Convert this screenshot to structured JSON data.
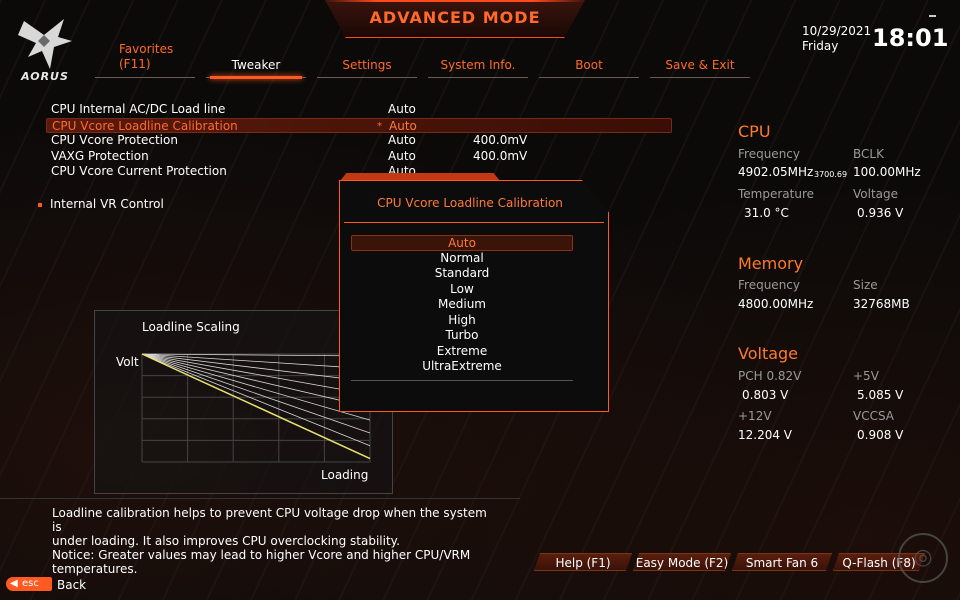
{
  "header": {
    "mode_title": "ADVANCED MODE",
    "logo_text": "AORUS",
    "date": "10/29/2021",
    "day": "Friday",
    "time": "18:01"
  },
  "tabs": [
    {
      "label": "Favorites",
      "sublabel": "(F11)"
    },
    {
      "label": "Tweaker",
      "active": true
    },
    {
      "label": "Settings"
    },
    {
      "label": "System Info."
    },
    {
      "label": "Boot"
    },
    {
      "label": "Save & Exit"
    }
  ],
  "settings": [
    {
      "label": "CPU Internal AC/DC Load line",
      "value": "Auto",
      "value2": ""
    },
    {
      "label": "CPU Vcore Loadline Calibration",
      "value": "Auto",
      "value2": "",
      "selected": true,
      "modified_mark": "*"
    },
    {
      "label": "CPU Vcore Protection",
      "value": "Auto",
      "value2": "400.0mV"
    },
    {
      "label": "VAXG Protection",
      "value": "Auto",
      "value2": "400.0mV"
    },
    {
      "label": "CPU Vcore Current Protection",
      "value": "Auto",
      "value2": ""
    }
  ],
  "subitem": {
    "label": "Internal VR Control"
  },
  "chart": {
    "title": "Loadline Scaling",
    "ylabel": "Volt",
    "xlabel": "Loading"
  },
  "popup": {
    "title": "CPU Vcore Loadline Calibration",
    "options": [
      "Auto",
      "Normal",
      "Standard",
      "Low",
      "Medium",
      "High",
      "Turbo",
      "Extreme",
      "UltraExtreme"
    ],
    "selected_index": 0
  },
  "info": {
    "cpu": {
      "heading": "CPU",
      "frequency_label": "Frequency",
      "frequency_value": "4902.05MHz",
      "frequency_sub": "3700.69",
      "bclk_label": "BCLK",
      "bclk_value": "100.00MHz",
      "temperature_label": "Temperature",
      "temperature_value": "31.0 °C",
      "voltage_label": "Voltage",
      "voltage_value": "0.936 V"
    },
    "memory": {
      "heading": "Memory",
      "frequency_label": "Frequency",
      "frequency_value": "4800.00MHz",
      "size_label": "Size",
      "size_value": "32768MB"
    },
    "voltage": {
      "heading": "Voltage",
      "pch_label": "PCH 0.82V",
      "pch_value": "0.803 V",
      "v5_label": "+5V",
      "v5_value": "5.085 V",
      "v12_label": "+12V",
      "v12_value": "12.204 V",
      "vccsa_label": "VCCSA",
      "vccsa_value": "0.908 V"
    }
  },
  "description": [
    "Loadline calibration helps to prevent CPU voltage drop when the system is",
    "under loading. It also improves CPU overclocking stability.",
    "Notice: Greater values may lead to higher Vcore and higher CPU/VRM",
    "temperatures."
  ],
  "bottom_buttons": [
    "Help (F1)",
    "Easy Mode (F2)",
    "Smart Fan 6 (F6)",
    "Q-Flash (F8)"
  ],
  "footer": {
    "esc_label": "esc",
    "back_label": "Back"
  },
  "colors": {
    "accent": "#ff5a22",
    "accent_text": "#ff7a3a",
    "label_gray": "#9a9a9a"
  }
}
